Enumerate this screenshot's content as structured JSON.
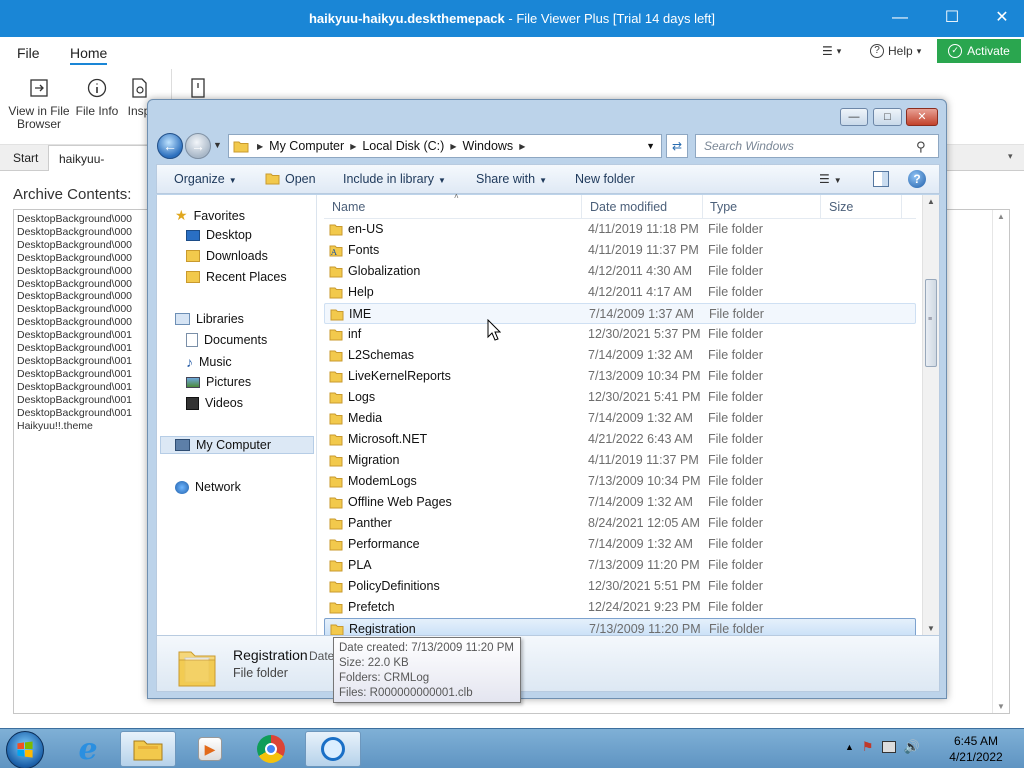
{
  "fileviewer": {
    "title_bold": "haikyuu-haikyu.deskthemepack",
    "title_rest": " - File Viewer Plus [Trial 14 days left]",
    "tabs": [
      "File",
      "Home"
    ],
    "settings_label": "",
    "help_label": "Help",
    "activate_label": "Activate",
    "ribbon": {
      "view_in_browser_line1": "View in File",
      "view_in_browser_line2": "Browser",
      "file_info": "File Info",
      "inspect": "Insp"
    },
    "doc_tabs": [
      "Start",
      "haikyuu-haikyu.d"
    ],
    "archive_label": "Archive Contents:",
    "archive_items": [
      "DesktopBackground\\000",
      "DesktopBackground\\000",
      "DesktopBackground\\000",
      "DesktopBackground\\000",
      "DesktopBackground\\000",
      "DesktopBackground\\000",
      "DesktopBackground\\000",
      "DesktopBackground\\000",
      "DesktopBackground\\000",
      "DesktopBackground\\001",
      "DesktopBackground\\001",
      "DesktopBackground\\001",
      "DesktopBackground\\001",
      "DesktopBackground\\001",
      "DesktopBackground\\001",
      "DesktopBackground\\001",
      "Haikyuu!!.theme"
    ]
  },
  "explorer": {
    "breadcrumb": [
      "My Computer",
      "Local Disk (C:)",
      "Windows"
    ],
    "search_placeholder": "Search Windows",
    "commands": {
      "organize": "Organize",
      "open": "Open",
      "include": "Include in library",
      "share": "Share with",
      "newfolder": "New folder"
    },
    "nav": {
      "favorites": "Favorites",
      "desktop": "Desktop",
      "downloads": "Downloads",
      "recent": "Recent Places",
      "libraries": "Libraries",
      "documents": "Documents",
      "music": "Music",
      "pictures": "Pictures",
      "videos": "Videos",
      "mycomputer": "My Computer",
      "network": "Network"
    },
    "columns": {
      "name": "Name",
      "date": "Date modified",
      "type": "Type",
      "size": "Size"
    },
    "files": [
      {
        "name": "en-US",
        "date": "4/11/2019 11:18 PM",
        "type": "File folder"
      },
      {
        "name": "Fonts",
        "date": "4/11/2019 11:37 PM",
        "type": "File folder"
      },
      {
        "name": "Globalization",
        "date": "4/12/2011 4:30 AM",
        "type": "File folder"
      },
      {
        "name": "Help",
        "date": "4/12/2011 4:17 AM",
        "type": "File folder"
      },
      {
        "name": "IME",
        "date": "7/14/2009 1:37 AM",
        "type": "File folder"
      },
      {
        "name": "inf",
        "date": "12/30/2021 5:37 PM",
        "type": "File folder"
      },
      {
        "name": "L2Schemas",
        "date": "7/14/2009 1:32 AM",
        "type": "File folder"
      },
      {
        "name": "LiveKernelReports",
        "date": "7/13/2009 10:34 PM",
        "type": "File folder"
      },
      {
        "name": "Logs",
        "date": "12/30/2021 5:41 PM",
        "type": "File folder"
      },
      {
        "name": "Media",
        "date": "7/14/2009 1:32 AM",
        "type": "File folder"
      },
      {
        "name": "Microsoft.NET",
        "date": "4/21/2022 6:43 AM",
        "type": "File folder"
      },
      {
        "name": "Migration",
        "date": "4/11/2019 11:37 PM",
        "type": "File folder"
      },
      {
        "name": "ModemLogs",
        "date": "7/13/2009 10:34 PM",
        "type": "File folder"
      },
      {
        "name": "Offline Web Pages",
        "date": "7/14/2009 1:32 AM",
        "type": "File folder"
      },
      {
        "name": "Panther",
        "date": "8/24/2021 12:05 AM",
        "type": "File folder"
      },
      {
        "name": "Performance",
        "date": "7/14/2009 1:32 AM",
        "type": "File folder"
      },
      {
        "name": "PLA",
        "date": "7/13/2009 11:20 PM",
        "type": "File folder"
      },
      {
        "name": "PolicyDefinitions",
        "date": "12/30/2021 5:51 PM",
        "type": "File folder"
      },
      {
        "name": "Prefetch",
        "date": "12/24/2021 9:23 PM",
        "type": "File folder"
      },
      {
        "name": "Registration",
        "date": "7/13/2009 11:20 PM",
        "type": "File folder"
      }
    ],
    "details": {
      "name": "Registration",
      "date_prefix": "Date",
      "type": "File folder"
    },
    "tooltip": {
      "created": "Date created: 7/13/2009 11:20 PM",
      "size": "Size: 22.0 KB",
      "folders": "Folders: CRMLog",
      "files": "Files: R000000000001.clb"
    }
  },
  "taskbar": {
    "time": "6:45 AM",
    "date": "4/21/2022"
  }
}
